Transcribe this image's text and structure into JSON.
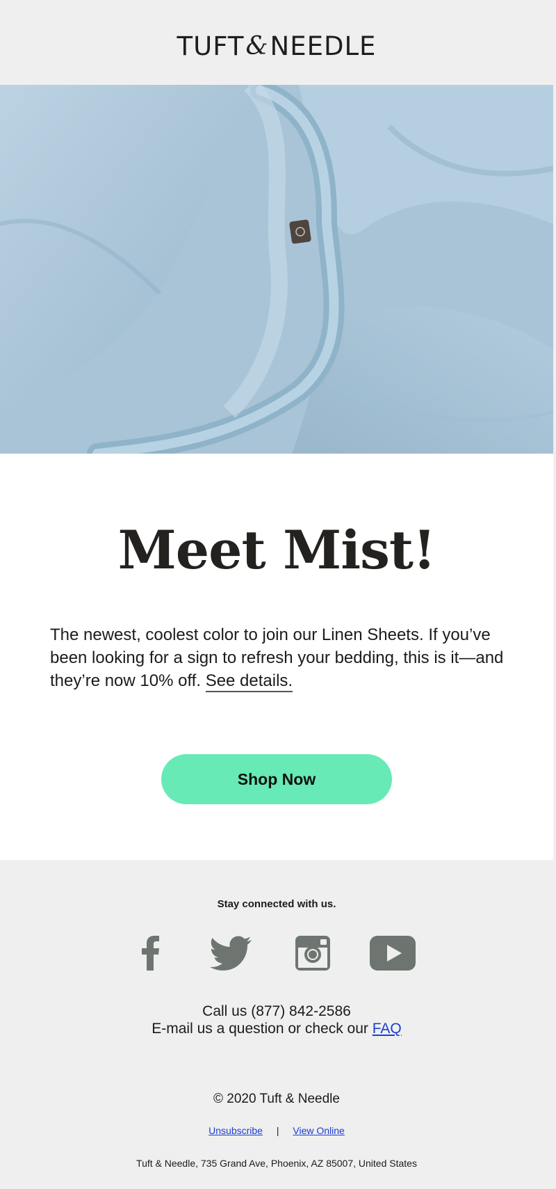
{
  "header": {
    "logo_left": "TUFT",
    "logo_amp": "&",
    "logo_right": "NEEDLE"
  },
  "hero": {
    "image_alt": "Mist blue linen fitted sheet"
  },
  "main": {
    "title": "Meet Mist!",
    "body": "The newest, coolest color to join our Linen Sheets. If you’ve been looking for a sign to refresh your bedding, this is it—and they’re now 10% off. ",
    "details_link": "See details.",
    "cta_label": "Shop Now"
  },
  "footer": {
    "stay_connected": "Stay connected with us.",
    "social_icons": [
      "facebook-icon",
      "twitter-icon",
      "instagram-icon",
      "youtube-icon"
    ],
    "phone_line": "Call us (877) 842-2586",
    "email_line": "E-mail us a question or check our ",
    "faq_link": "FAQ",
    "copyright": "© 2020 Tuft & Needle",
    "unsubscribe": "Unsubscribe",
    "separator": "|",
    "view_online": "View Online",
    "address": "Tuft & Needle, 735 Grand Ave, Phoenix, AZ 85007, United States"
  },
  "colors": {
    "cta": "#67eab6",
    "link": "#1a3fd1",
    "icon": "#6e7571",
    "background": "#efefef"
  }
}
